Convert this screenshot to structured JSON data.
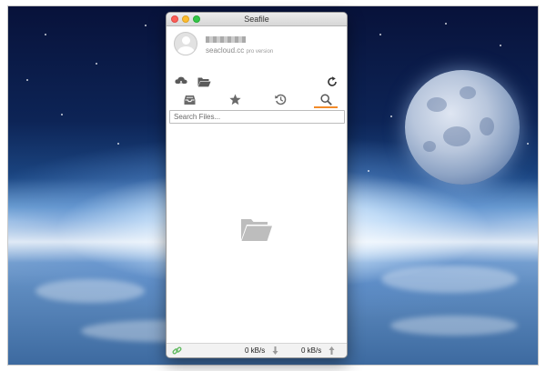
{
  "window": {
    "title": "Seafile"
  },
  "account": {
    "server": "seacloud.cc",
    "edition": "pro version",
    "icons": {
      "avatar": "user-avatar-icon",
      "download": "cloud-download-icon",
      "open_folder": "open-folder-icon",
      "refresh": "refresh-icon"
    }
  },
  "tabs": [
    {
      "name": "libraries",
      "icon": "inbox-tray-icon",
      "active": false
    },
    {
      "name": "starred",
      "icon": "star-icon",
      "active": false
    },
    {
      "name": "activity",
      "icon": "history-icon",
      "active": false
    },
    {
      "name": "search",
      "icon": "search-icon",
      "active": true
    }
  ],
  "search": {
    "placeholder": "Search Files..."
  },
  "status": {
    "download_rate": "0 kB/s",
    "upload_rate": "0 kB/s",
    "connection_icon": "link-icon"
  },
  "colors": {
    "accent": "#f28b29",
    "connected": "#5cb85c",
    "icon_gray": "#555555"
  }
}
